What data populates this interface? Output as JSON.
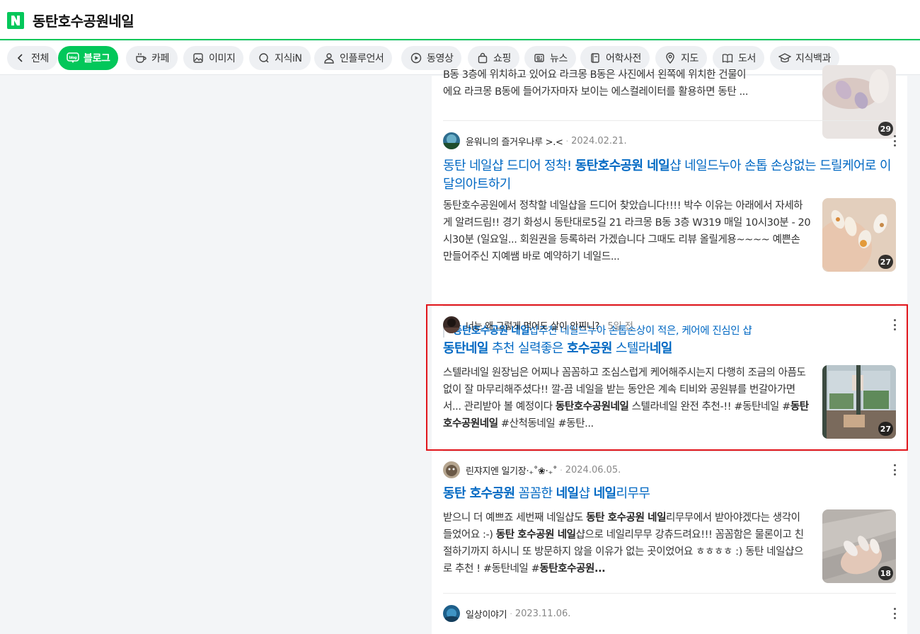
{
  "search": {
    "query": "동탄호수공원네일"
  },
  "tabs": [
    {
      "label": "전체",
      "icon": "chevron-left-icon"
    },
    {
      "label": "블로그",
      "icon": "blog-icon",
      "active": true
    },
    {
      "label": "카페",
      "icon": "cafe-icon"
    },
    {
      "label": "이미지",
      "icon": "image-icon"
    },
    {
      "label": "지식iN",
      "icon": "kin-icon"
    },
    {
      "label": "인플루언서",
      "icon": "person-icon"
    },
    {
      "label": "동영상",
      "icon": "play-icon"
    },
    {
      "label": "쇼핑",
      "icon": "shopping-bag-icon"
    },
    {
      "label": "뉴스",
      "icon": "news-icon"
    },
    {
      "label": "어학사전",
      "icon": "dictionary-icon"
    },
    {
      "label": "지도",
      "icon": "map-pin-icon"
    },
    {
      "label": "도서",
      "icon": "book-icon"
    },
    {
      "label": "지식백과",
      "icon": "graduation-cap-icon"
    }
  ],
  "results": [
    {
      "desc_lines": [
        "B동 3층에 위치하고 있어요 라크몽 B동은 사진에서 왼쪽에 위치한 건물이",
        "에요 라크몽 B동에 들어가자마자 보이는 에스컬레이터를 활용하면 동탄 ..."
      ],
      "thumb_count": "29"
    },
    {
      "author": "윤워니의 즐거우나루 >.<",
      "date": "2024.02.21.",
      "title_parts": [
        {
          "text": "동탄 네일샵 드디어 정착! ",
          "bold": false
        },
        {
          "text": "동탄호수공원 네일",
          "bold": true
        },
        {
          "text": "샵 네일드누아 손톱 손상없는 드릴케어로 이달의아트하기",
          "bold": false
        }
      ],
      "desc": "동탄호수공원에서 정착할 네일샵을 드디어 찾았습니다!!!! 박수 이유는 아래에서 자세하게 알려드림!! 경기 화성시 동탄대로5길 21 라크몽 B동 3층 W319 매일 10시30분 - 20시30분 (일요일... 회원권을 등록하러 가겠습니다 그때도 리뷰 올릴게용~~~~ 예쁜손 만들어주신 지예쌤 바로 예약하기 네일드...",
      "thumb_count": "27",
      "sublink": {
        "bold": "동탄호수공원 네일",
        "text": "샵추천 네일드누아 손톱손상이 적은, 케어에 진심인 샵"
      }
    },
    {
      "author": "너는 왜 그렇게 먹어도 살이 안찌니?",
      "date": "5일 전",
      "title_parts": [
        {
          "text": "동탄네일",
          "bold": true
        },
        {
          "text": " 추천 실력좋은 ",
          "bold": false
        },
        {
          "text": "호수공원",
          "bold": true
        },
        {
          "text": " 스텔라",
          "bold": false
        },
        {
          "text": "네일",
          "bold": true
        }
      ],
      "desc_parts": [
        {
          "text": "스텔라네일 원장님은 어찌나 꼼꼼하고 조심스럽게 케어해주시는지 다행히 조금의 아픔도 없이 잘 마무리해주셨다!! 깔-끔 네일을 받는 동안은 계속 티비와 공원뷰를 번갈아가면서... 관리받아 볼 예정이다 ",
          "bold": false
        },
        {
          "text": "동탄호수공원네일",
          "bold": true
        },
        {
          "text": " 스텔라네일 완전 추천-!! #동탄네일 #",
          "bold": false
        },
        {
          "text": "동탄호수공원네일",
          "bold": true
        },
        {
          "text": " #산척동네일 #동탄...",
          "bold": false
        }
      ],
      "thumb_count": "27"
    },
    {
      "author": "린쟈지엔 일기장·₊˚❀·₊˚",
      "date": "2024.06.05.",
      "title_parts": [
        {
          "text": "동탄 호수공원",
          "bold": true
        },
        {
          "text": " 꼼꼼한 ",
          "bold": false
        },
        {
          "text": "네일",
          "bold": true
        },
        {
          "text": "샵 ",
          "bold": false
        },
        {
          "text": "네일",
          "bold": true
        },
        {
          "text": "리무무",
          "bold": false
        }
      ],
      "desc_parts": [
        {
          "text": "받으니 더 예쁘죠 세번째 네일샵도 ",
          "bold": false
        },
        {
          "text": "동탄 호수공원 네일",
          "bold": true
        },
        {
          "text": "리무무에서 받아야겠다는 생각이 들었어요 :-) ",
          "bold": false
        },
        {
          "text": "동탄 호수공원 네일",
          "bold": true
        },
        {
          "text": "샵으로 네일리무무 강츄드려요!!! 꼼꼼함은 물론이고 친절하기까지 하시니 또 방문하지 않을 이유가 없는 곳이었어요 ㅎㅎㅎㅎ :) 동탄 네일샵으로 추천 ! #동탄네일 #",
          "bold": false
        },
        {
          "text": "동탄호수공원...",
          "bold": true
        }
      ],
      "thumb_count": "18"
    },
    {
      "author": "일상이야기",
      "date": "2023.11.06."
    }
  ],
  "colors": {
    "brand": "#03c75a",
    "link": "#0068c3",
    "highlight": "#e1151b"
  }
}
